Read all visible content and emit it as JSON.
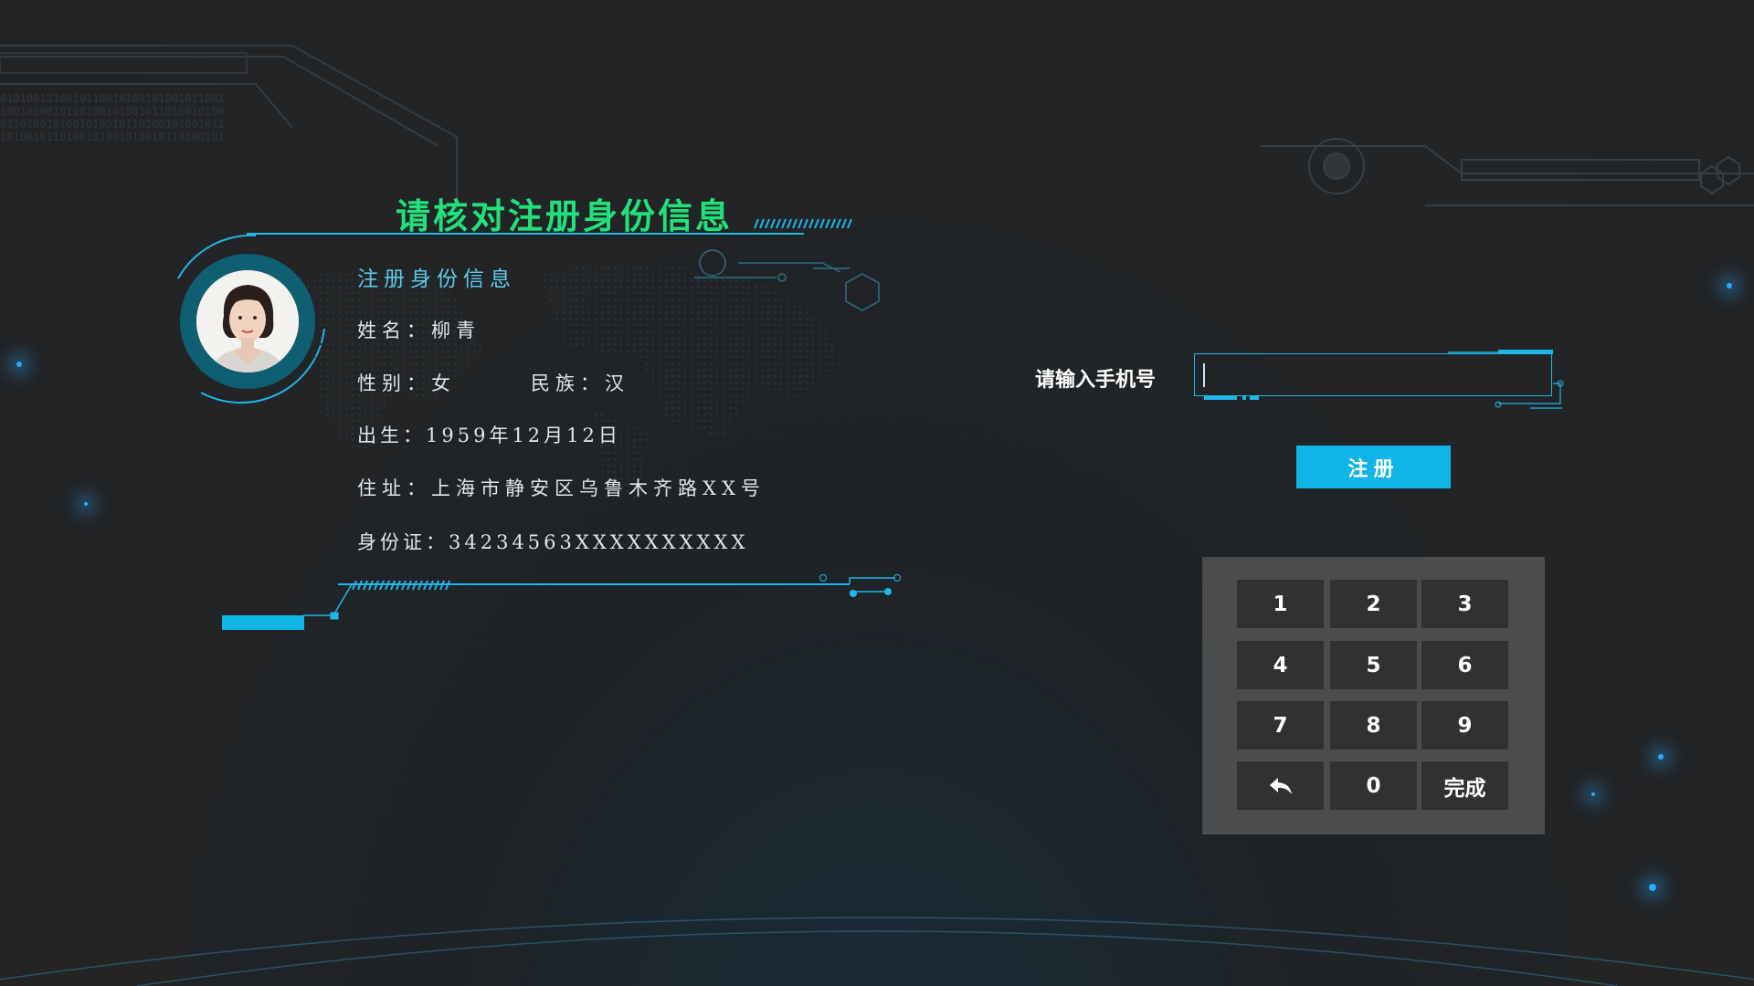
{
  "title": "请核对注册身份信息",
  "section_label": "注册身份信息",
  "fields": {
    "name": "姓名：柳青",
    "gender": "性别：女",
    "ethnicity": "民族：汉",
    "birth": "出生：1959年12月12日",
    "address": "住址：上海市静安区乌鲁木齐路XX号",
    "id_card": "身份证：34234563XXXXXXXXXX"
  },
  "phone": {
    "label": "请输入手机号",
    "value": "",
    "register_label": "注册"
  },
  "keypad": {
    "keys": [
      "1",
      "2",
      "3",
      "4",
      "5",
      "6",
      "7",
      "8",
      "9",
      "back",
      "0",
      "完成"
    ],
    "back_icon": "undo-arrow-icon",
    "done_label": "完成"
  },
  "colors": {
    "accent": "#10b5e8",
    "title": "#22e07a",
    "section": "#5ec9e8"
  }
}
